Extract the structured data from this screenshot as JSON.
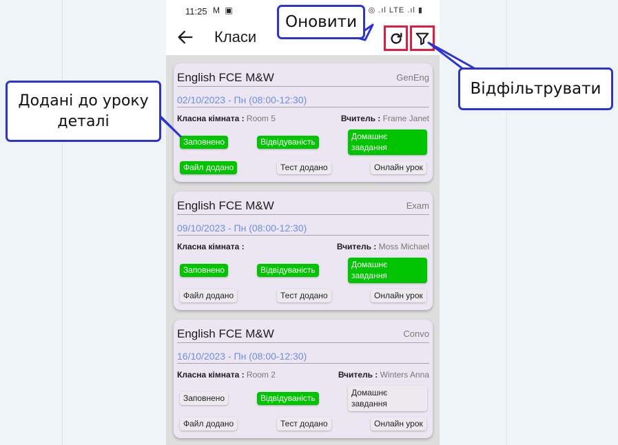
{
  "status_bar": {
    "time": "11:25",
    "left_icons": "M ▣",
    "right_icons": "◎ .ıl LTE .ıl ▮"
  },
  "app_bar": {
    "title": "Класи"
  },
  "labels": {
    "classroom": "Класна кімната :",
    "teacher": "Вчитель :"
  },
  "lessons": [
    {
      "course": "English FCE M&W",
      "level": "GenEng",
      "date": "02/10/2023 - Пн (08:00-12:30)",
      "room": "Room 5",
      "teacher": "Frame Janet",
      "chips": {
        "filled": "Заповнено",
        "attendance": "Відвідуваність",
        "homework": "Домашнє завдання",
        "file": "Файл додано",
        "test": "Тест додано",
        "online": "Онлайн урок"
      },
      "states": {
        "filled": true,
        "attendance": true,
        "homework": true,
        "file": true,
        "test": false,
        "online": false
      }
    },
    {
      "course": "English FCE M&W",
      "level": "Exam",
      "date": "09/10/2023 - Пн (08:00-12:30)",
      "room": "",
      "teacher": "Moss Michael",
      "chips": {
        "filled": "Заповнено",
        "attendance": "Відвідуваність",
        "homework": "Домашнє завдання",
        "file": "Файл додано",
        "test": "Тест додано",
        "online": "Онлайн урок"
      },
      "states": {
        "filled": true,
        "attendance": true,
        "homework": true,
        "file": false,
        "test": false,
        "online": false
      }
    },
    {
      "course": "English FCE M&W",
      "level": "Convo",
      "date": "16/10/2023 - Пн (08:00-12:30)",
      "room": "Room 2",
      "teacher": "Winters Anna",
      "chips": {
        "filled": "Заповнено",
        "attendance": "Відвідуваність",
        "homework": "Домашнє завдання",
        "file": "Файл додано",
        "test": "Тест додано",
        "online": "Онлайн урок"
      },
      "states": {
        "filled": false,
        "attendance": true,
        "homework": false,
        "file": false,
        "test": false,
        "online": false
      }
    }
  ],
  "callouts": {
    "refresh": "Оновити",
    "filter": "Відфільтрувати",
    "details": "Додані до уроку деталі"
  },
  "colors": {
    "active_chip": "#00c400",
    "inactive_chip": "#eceaee",
    "highlight": "#e8193f",
    "callout_border": "#2b33d6",
    "date_text": "#6d8ee6"
  },
  "icons": {
    "back": "arrow-left-icon",
    "refresh": "refresh-icon",
    "filter": "filter-icon"
  }
}
